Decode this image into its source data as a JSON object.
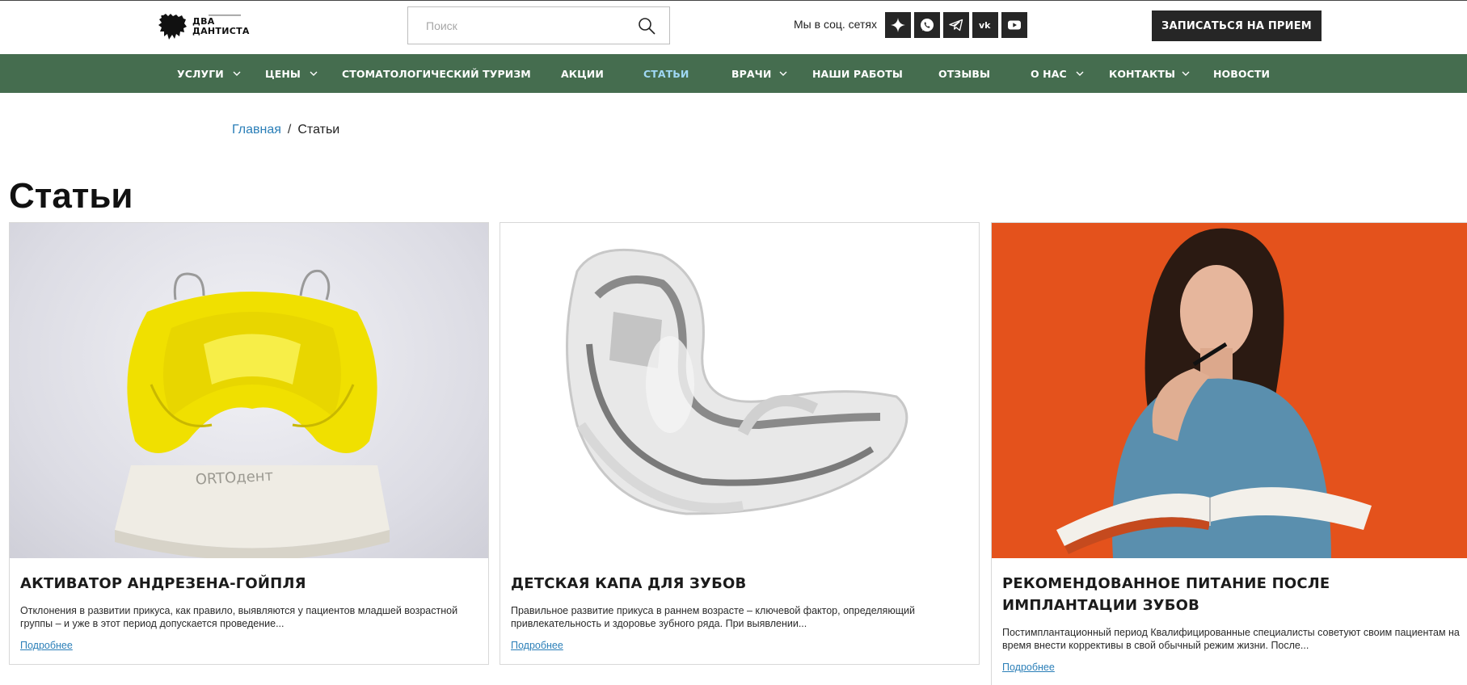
{
  "header": {
    "logo_line1": "ДВА",
    "logo_line2": "ДАНТИСТА",
    "search_placeholder": "Поиск",
    "social_label": "Мы в соц. сетях",
    "social_icons": [
      "sparkle-icon",
      "whatsapp-icon",
      "telegram-icon",
      "vk-icon",
      "youtube-icon"
    ],
    "cta_label": "ЗАПИСАТЬСЯ НА ПРИЕМ"
  },
  "nav": {
    "items": [
      {
        "label": "УСЛУГИ",
        "dropdown": true
      },
      {
        "label": "ЦЕНЫ",
        "dropdown": true
      },
      {
        "label": "СТОМАТОЛОГИЧЕСКИЙ ТУРИЗМ",
        "dropdown": false
      },
      {
        "label": "АКЦИИ",
        "dropdown": false
      },
      {
        "label": "СТАТЬИ",
        "dropdown": false,
        "active": true
      },
      {
        "label": "ВРАЧИ",
        "dropdown": true
      },
      {
        "label": "НАШИ РАБОТЫ",
        "dropdown": false
      },
      {
        "label": "ОТЗЫВЫ",
        "dropdown": false
      },
      {
        "label": "О НАС",
        "dropdown": true
      },
      {
        "label": "КОНТАКТЫ",
        "dropdown": true
      },
      {
        "label": "НОВОСТИ",
        "dropdown": false
      }
    ]
  },
  "breadcrumb": {
    "home": "Главная",
    "separator": "/",
    "current": "Статьи"
  },
  "page_title": "Статьи",
  "cards": [
    {
      "title": "АКТИВАТОР АНДРЕЗЕНА-ГОЙПЛЯ",
      "text": "Отклонения в развитии прикуса, как правило, выявляются у пациентов младшей возрастной группы – и уже в этот период допускается проведение...",
      "link": "Подробнее"
    },
    {
      "title": "ДЕТСКАЯ КАПА ДЛЯ ЗУБОВ",
      "text": "Правильное развитие прикуса в раннем возрасте – ключевой фактор, определяющий привлекательность и здоровье зубного ряда. При выявлении...",
      "link": "Подробнее"
    },
    {
      "title": "РЕКОМЕНДОВАННОЕ ПИТАНИЕ ПОСЛЕ ИМПЛАНТАЦИИ ЗУБОВ",
      "text": "Постимплантационный период Квалифицированные специалисты советуют своим пациентам на время внести коррективы в свой обычный режим жизни. После...",
      "link": "Подробнее"
    }
  ],
  "colors": {
    "nav_bg": "#456d4f",
    "nav_active": "#9fd8f4",
    "link": "#2b7fb8",
    "dark_button": "#262626",
    "card3_bg": "#e4521c"
  }
}
